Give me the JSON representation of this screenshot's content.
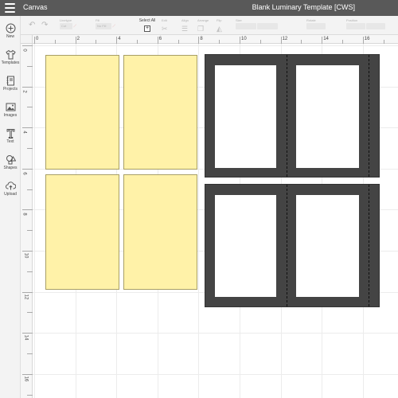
{
  "topbar": {
    "app_title": "Canvas",
    "document_title": "Blank Luminary Template [CWS]"
  },
  "toolbar": {
    "linetype_label": "Linetype",
    "linetype_value": "Cut",
    "fill_label": "Fill",
    "fill_value": "No Fill",
    "select_all_label": "Select All",
    "edit_label": "Edit",
    "align_label": "Align",
    "arrange_label": "Arrange",
    "flip_label": "Flip",
    "size_label": "Size",
    "rotate_label": "Rotate",
    "position_label": "Position"
  },
  "sidebar": {
    "items": [
      {
        "label": "New",
        "icon": "plus-circle-icon"
      },
      {
        "label": "Templates",
        "icon": "tshirt-icon"
      },
      {
        "label": "Projects",
        "icon": "notebook-icon"
      },
      {
        "label": "Images",
        "icon": "image-icon"
      },
      {
        "label": "Text",
        "icon": "text-icon"
      },
      {
        "label": "Shapes",
        "icon": "shapes-icon"
      },
      {
        "label": "Upload",
        "icon": "cloud-upload-icon"
      }
    ]
  },
  "rulers": {
    "top_labels": [
      "0",
      "2",
      "4",
      "6",
      "8",
      "10",
      "12",
      "14",
      "16"
    ],
    "left_labels": [
      "0",
      "2",
      "4",
      "6",
      "8",
      "10",
      "12",
      "14",
      "16"
    ]
  },
  "colors": {
    "topbar": "#595959",
    "card_fill": "#fff2a8",
    "frame_fill": "#444444"
  }
}
